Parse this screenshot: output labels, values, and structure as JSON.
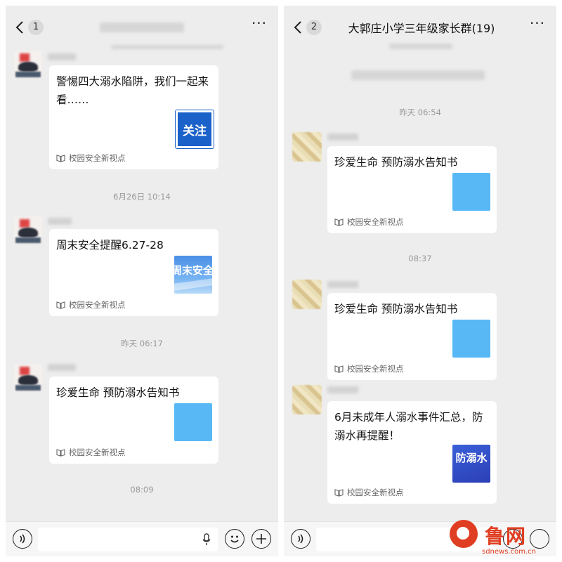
{
  "left_panel": {
    "badge": "1",
    "title": "",
    "cards": [
      {
        "title": "警惕四大溺水陷阱，我们一起来看……",
        "thumb_text": "关注",
        "source": "校园安全新视点"
      },
      {
        "title": "周末安全提醒6.27-28",
        "thumb_text": "周末安全",
        "source": "校园安全新视点"
      },
      {
        "title": "珍爱生命 预防溺水告知书",
        "thumb_text": "",
        "source": "校园安全新视点"
      }
    ],
    "timestamps": [
      "6月26日 10:14",
      "昨天 06:17",
      "08:09"
    ]
  },
  "right_panel": {
    "badge": "2",
    "title": "大郭庄小学三年级家长群(19)",
    "timestamps": [
      "昨天 06:54",
      "08:37"
    ],
    "cards": [
      {
        "title": "珍爱生命 预防溺水告知书",
        "thumb_text": "",
        "source": "校园安全新视点"
      },
      {
        "title": "珍爱生命 预防溺水告知书",
        "thumb_text": "",
        "source": "校园安全新视点"
      },
      {
        "title": "6月未成年人溺水事件汇总，防溺水再提醒！",
        "thumb_text": "防溺水",
        "source": "校园安全新视点"
      }
    ]
  },
  "watermark": {
    "brand": "鲁网",
    "url": "sdnews.com.cn"
  },
  "colors": {
    "chat_bg": "#ededed",
    "card_bg": "#ffffff",
    "thumb_blue": "#58b8f6",
    "brand_red": "#e03e22"
  },
  "icons": [
    "back-chevron-icon",
    "more-dots-icon",
    "voice-icon",
    "microphone-icon",
    "emoji-icon",
    "plus-icon",
    "mini-program-book-icon"
  ]
}
